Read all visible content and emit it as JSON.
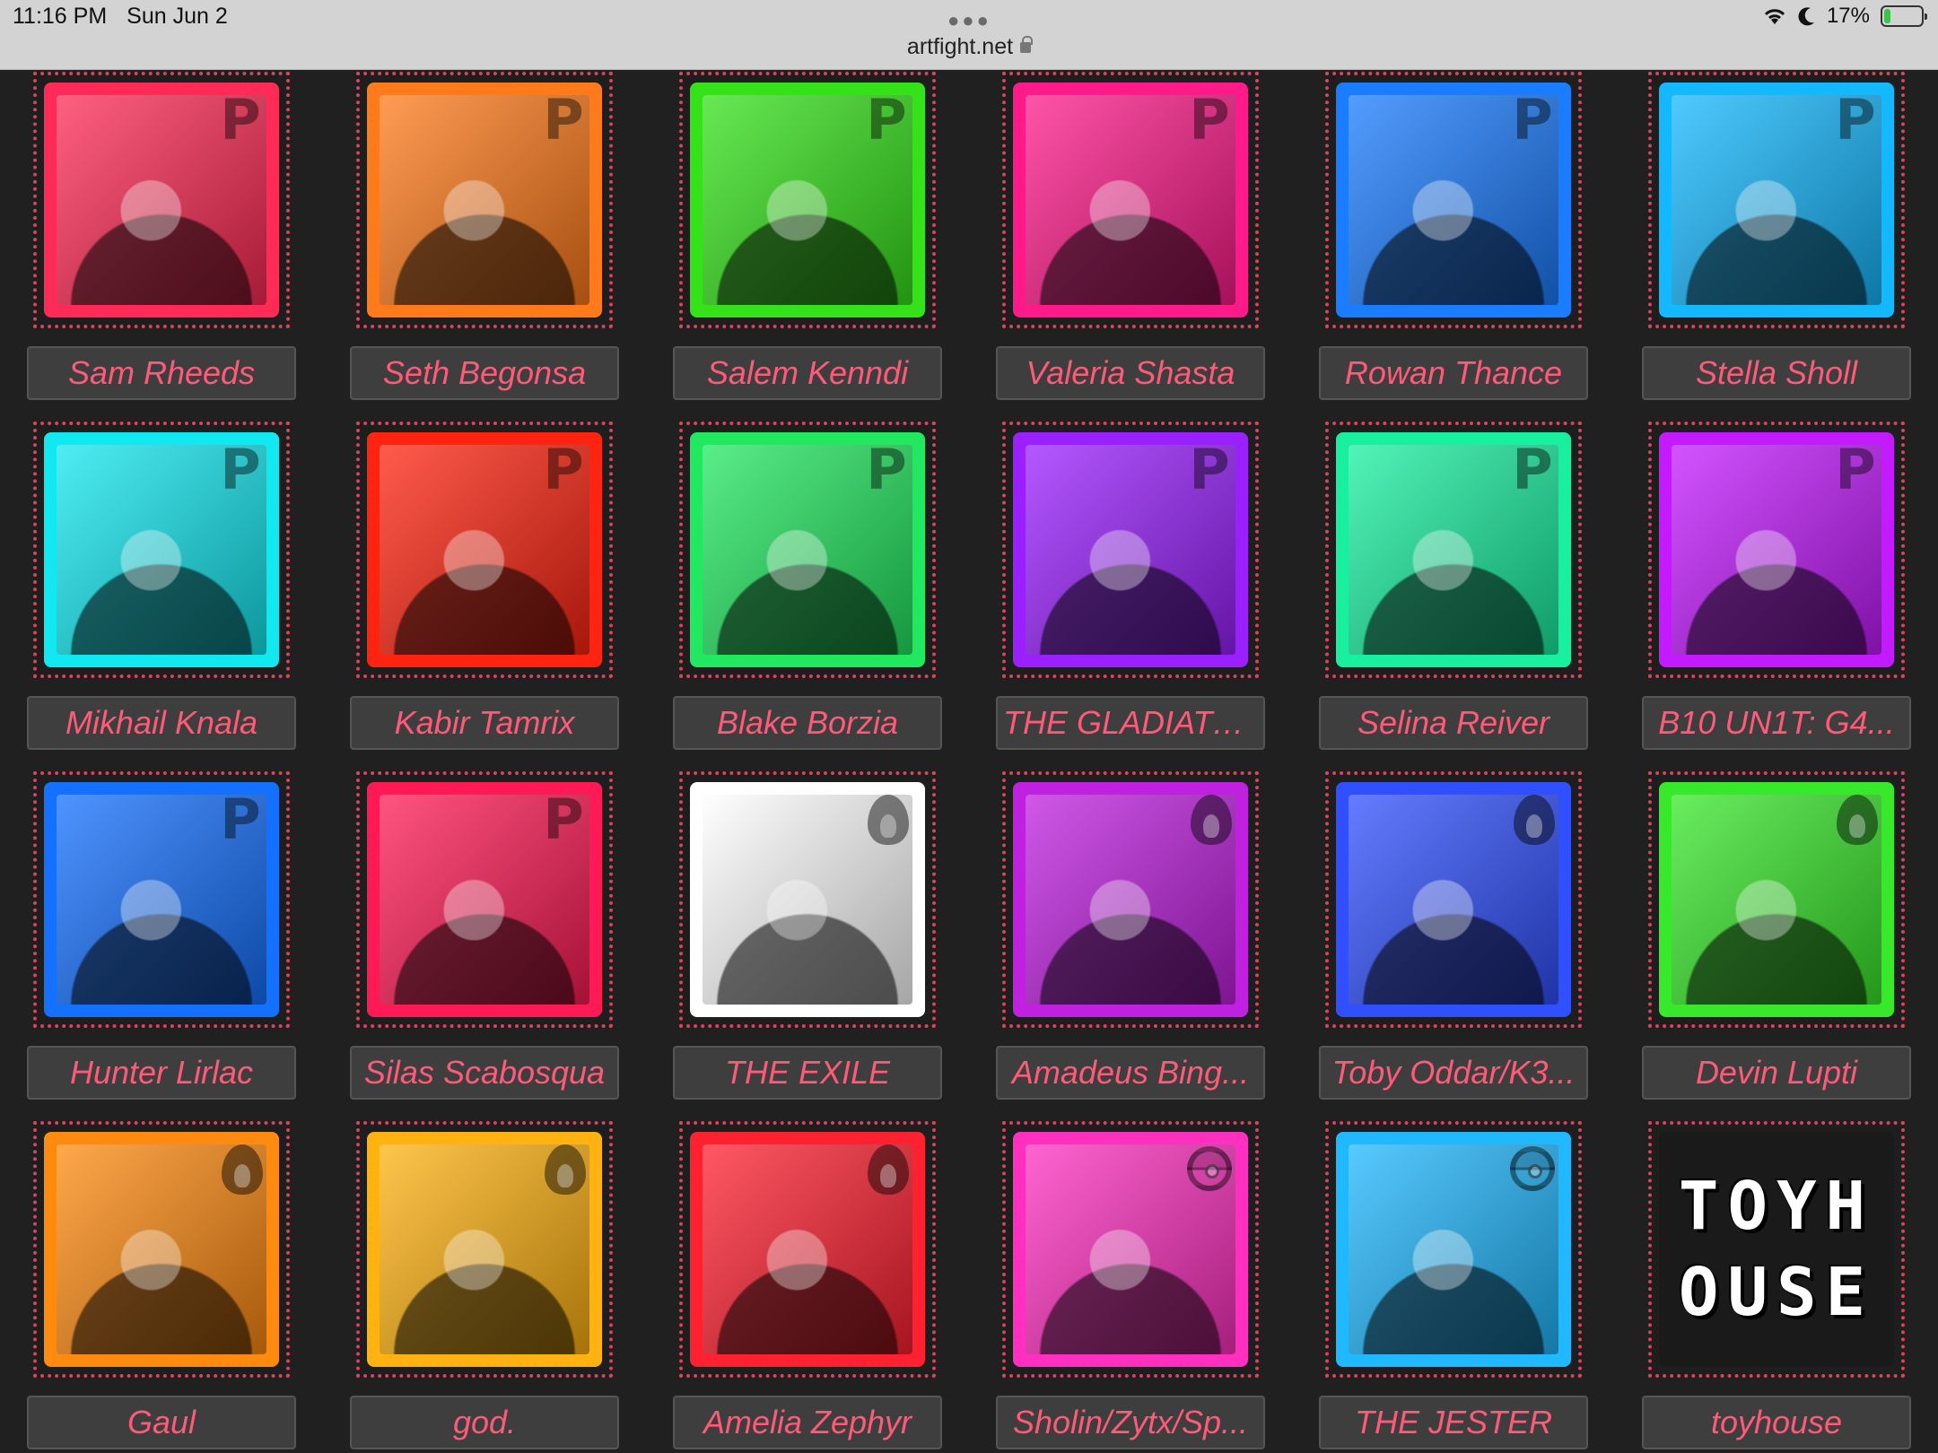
{
  "status_bar": {
    "time": "11:16 PM",
    "date": "Sun Jun 2",
    "url": "artfight.net",
    "battery_percent": "17%",
    "battery_level": 0.17
  },
  "badges": {
    "p": "P"
  },
  "characters": [
    {
      "name": "Sam Rheeds",
      "color": "#ff2a55",
      "badge": "p-icon"
    },
    {
      "name": "Seth Begonsa",
      "color": "#ff7a1a",
      "badge": "p-icon"
    },
    {
      "name": "Salem Kenndi",
      "color": "#35e21a",
      "badge": "p-icon"
    },
    {
      "name": "Valeria Shasta",
      "color": "#ff1a8a",
      "badge": "p-icon"
    },
    {
      "name": "Rowan Thance",
      "color": "#1a7cff",
      "badge": "p-icon"
    },
    {
      "name": "Stella Sholl",
      "color": "#14b8ff",
      "badge": "p-icon"
    },
    {
      "name": "Mikhail Knala",
      "color": "#12e8f0",
      "badge": "p-icon"
    },
    {
      "name": "Kabir Tamrix",
      "color": "#ff2410",
      "badge": "p-icon"
    },
    {
      "name": "Blake Borzia",
      "color": "#22e860",
      "badge": "p-icon"
    },
    {
      "name": "THE GLADIATOR",
      "color": "#9a20ff",
      "badge": "p-icon"
    },
    {
      "name": "Selina Reiver",
      "color": "#18f0a0",
      "badge": "p-icon"
    },
    {
      "name": "B10 UN1T: G4...",
      "color": "#c41aff",
      "badge": "p-icon"
    },
    {
      "name": "Hunter Lirlac",
      "color": "#1470ff",
      "badge": "p-icon"
    },
    {
      "name": "Silas Scabosqua",
      "color": "#ff1a55",
      "badge": "p-icon"
    },
    {
      "name": "THE EXILE",
      "color": "#ffffff",
      "badge": "flame-icon"
    },
    {
      "name": "Amadeus Bing...",
      "color": "#c020e0",
      "badge": "flame-icon"
    },
    {
      "name": "Toby Oddar/K3...",
      "color": "#3050ff",
      "badge": "flame-icon"
    },
    {
      "name": "Devin Lupti",
      "color": "#38e82a",
      "badge": "flame-icon"
    },
    {
      "name": "Gaul",
      "color": "#ff8a10",
      "badge": "flame-icon"
    },
    {
      "name": "god.",
      "color": "#ffb210",
      "badge": "flame-icon"
    },
    {
      "name": "Amelia Zephyr",
      "color": "#ff2030",
      "badge": "flame-icon"
    },
    {
      "name": "Sholin/Zytx/Sp...",
      "color": "#ff30c0",
      "badge": "pokeball-icon"
    },
    {
      "name": "THE JESTER",
      "color": "#20b8ff",
      "badge": "pokeball-icon"
    },
    {
      "name": "toyhouse",
      "color": "#1a1a1a",
      "badge": "toyhouse-logo"
    }
  ],
  "toyhouse_logo": [
    "TOYH",
    "OUSE"
  ]
}
